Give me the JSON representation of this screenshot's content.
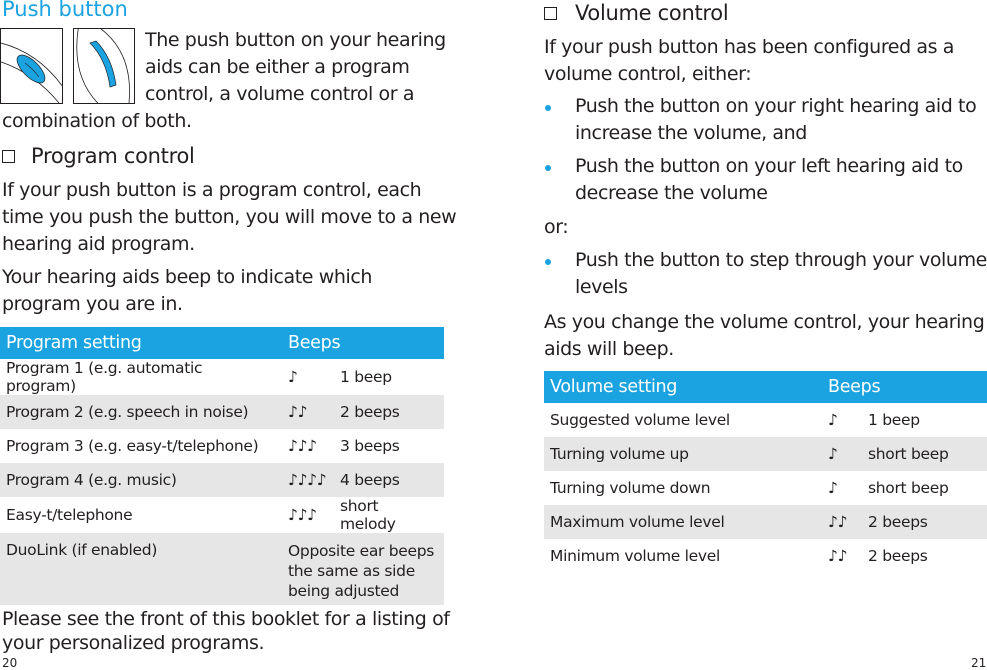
{
  "left_page": {
    "title": "Push button",
    "intro_line1": "The push button on your hearing",
    "intro_line2": "aids can be either a program",
    "intro_line3": "control, a volume control or a",
    "intro_line4": "combination of both.",
    "program_control": {
      "heading": "Program control",
      "para1_line1": "If your push button is a program control, each",
      "para1_line2": "time you push the button, you will move to a new",
      "para1_line3": "hearing aid program.",
      "para2_line1": "Your hearing aids beep to indicate which",
      "para2_line2": "program you are in."
    },
    "table": {
      "headers": [
        "Program setting",
        "Beeps"
      ],
      "rows": [
        {
          "setting": "Program 1 (e.g. automatic program)",
          "notes": "♪",
          "beeps": "1 beep"
        },
        {
          "setting": "Program 2 (e.g. speech in noise)",
          "notes": "♪♪",
          "beeps": "2 beeps"
        },
        {
          "setting": "Program 3 (e.g. easy-t/telephone)",
          "notes": "♪♪♪",
          "beeps": "3 beeps"
        },
        {
          "setting": "Program 4 (e.g. music)",
          "notes": "♪♪♪♪",
          "beeps": "4 beeps"
        },
        {
          "setting": "Easy-t/telephone",
          "notes": "♪♪♪",
          "beeps": "short melody"
        },
        {
          "setting": "DuoLink (if enabled)",
          "notes": "",
          "beeps": "Opposite ear beeps the same as side being adjusted"
        }
      ]
    },
    "footer_line1": "Please see the front of this booklet for a listing of",
    "footer_line2": "your personalized programs.",
    "page_number": "20"
  },
  "right_page": {
    "volume_control": {
      "heading": "Volume control",
      "intro_line1": "If your push button has been configured as a",
      "intro_line2": "volume control, either:",
      "bullets": [
        {
          "line1": "Push the button on your right hearing aid to",
          "line2": "increase the volume, and"
        },
        {
          "line1": "Push the button on your left hearing aid to",
          "line2": "decrease the volume"
        }
      ],
      "or_label": "or:",
      "bullet3_line1": "Push the button to step through your volume",
      "bullet3_line2": "levels",
      "para_line1": "As you change the volume control, your hearing",
      "para_line2": "aids will beep."
    },
    "table": {
      "headers": [
        "Volume setting",
        "Beeps"
      ],
      "rows": [
        {
          "setting": "Suggested volume level",
          "notes": "♪",
          "beeps": "1 beep"
        },
        {
          "setting": "Turning volume up",
          "notes": "♪",
          "beeps": "short beep"
        },
        {
          "setting": "Turning volume down",
          "notes": "♪",
          "beeps": "short beep"
        },
        {
          "setting": "Maximum volume level",
          "notes": "♪♪",
          "beeps": "2 beeps"
        },
        {
          "setting": "Minimum volume level",
          "notes": "♪♪",
          "beeps": "2 beeps"
        }
      ]
    },
    "page_number": "21"
  },
  "colors": {
    "accent": "#1aa3e0",
    "row_alt": "#e6e6e6",
    "text": "#231f20"
  }
}
